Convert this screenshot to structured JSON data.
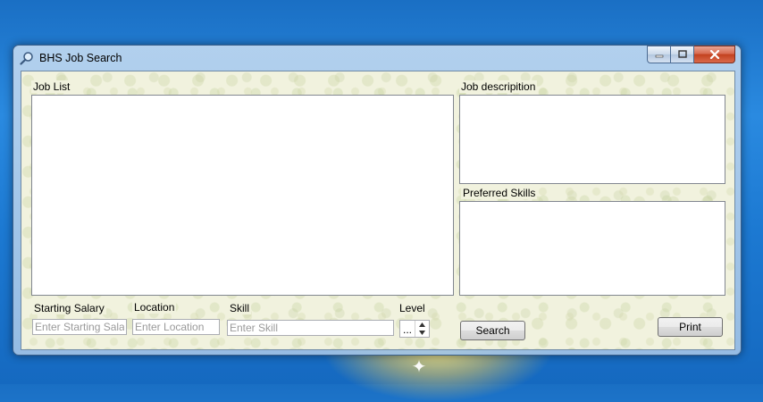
{
  "window": {
    "title": "BHS Job Search",
    "icons": {
      "app": "magnifier-icon",
      "minimize": "minimize-icon",
      "maximize": "maximize-icon",
      "close": "close-icon"
    }
  },
  "panels": {
    "job_list_label": "Job List",
    "job_description_label": "Job descripition",
    "preferred_skills_label": "Preferred Skills"
  },
  "filters": {
    "starting_salary": {
      "label": "Starting Salary",
      "placeholder": "Enter Starting Salary",
      "value": ""
    },
    "location": {
      "label": "Location",
      "placeholder": "Enter Location",
      "value": ""
    },
    "skill": {
      "label": "Skill",
      "placeholder": "Enter Skill",
      "value": ""
    },
    "level": {
      "label": "Level",
      "value": "..."
    }
  },
  "buttons": {
    "search": "Search",
    "print": "Print"
  },
  "colors": {
    "client_background": "#f1f2de",
    "close_button": "#c3421f",
    "desktop": "#1a6fc4"
  }
}
